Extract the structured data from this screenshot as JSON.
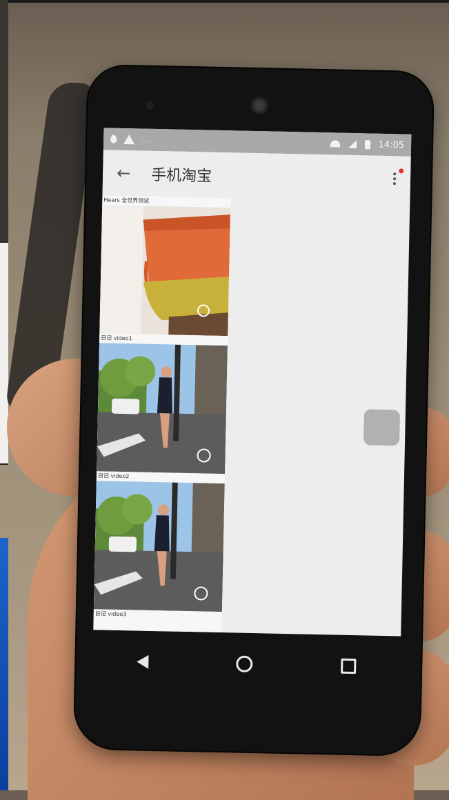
{
  "statusbar": {
    "time": "14:05"
  },
  "appbar": {
    "back_glyph": "←",
    "title": "手机淘宝"
  },
  "feed": {
    "items": [
      {
        "caption": "Hears 全世界测试"
      },
      {
        "caption": "日记 video1"
      },
      {
        "caption": "日记 video2"
      },
      {
        "caption": "日记 video3"
      }
    ]
  },
  "icons": {
    "back": "arrow-back-icon",
    "menu": "more-vert-icon",
    "nav_back": "triangle-back-icon",
    "nav_home": "circle-home-icon",
    "nav_recent": "square-recent-icon"
  },
  "colors": {
    "notification_dot": "#e5322d",
    "statusbar": "#a9a9a9",
    "screen_bg": "#ededed"
  }
}
